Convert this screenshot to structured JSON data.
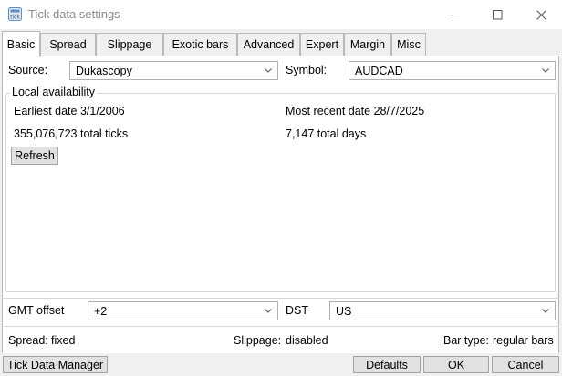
{
  "window": {
    "title": "Tick data settings"
  },
  "tabs": [
    {
      "label": "Basic",
      "active": true
    },
    {
      "label": "Spread"
    },
    {
      "label": "Slippage"
    },
    {
      "label": "Exotic bars"
    },
    {
      "label": "Advanced"
    },
    {
      "label": "Expert"
    },
    {
      "label": "Margin"
    },
    {
      "label": "Misc"
    }
  ],
  "source": {
    "label": "Source:",
    "value": "Dukascopy"
  },
  "symbol": {
    "label": "Symbol:",
    "value": "AUDCAD"
  },
  "local_availability": {
    "title": "Local availability",
    "earliest": "Earliest date 3/1/2006",
    "most_recent": "Most recent date 28/7/2025",
    "total_ticks": "355,076,723 total ticks",
    "total_days": "7,147 total days",
    "refresh_label": "Refresh"
  },
  "gmt": {
    "label": "GMT offset",
    "value": "+2"
  },
  "dst": {
    "label": "DST",
    "value": "US"
  },
  "status": {
    "spread_label": "Spread:",
    "spread_value": "fixed",
    "slippage_label": "Slippage:",
    "slippage_value": "disabled",
    "bartype_label": "Bar type:",
    "bartype_value": "regular bars"
  },
  "footer": {
    "tick_data_manager": "Tick Data Manager",
    "defaults": "Defaults",
    "ok": "OK",
    "cancel": "Cancel"
  },
  "icons": {
    "app": "tick-data-app-icon",
    "minimize": "minimize-icon",
    "maximize": "maximize-icon",
    "close": "close-icon",
    "dropdown": "chevron-down-icon"
  }
}
